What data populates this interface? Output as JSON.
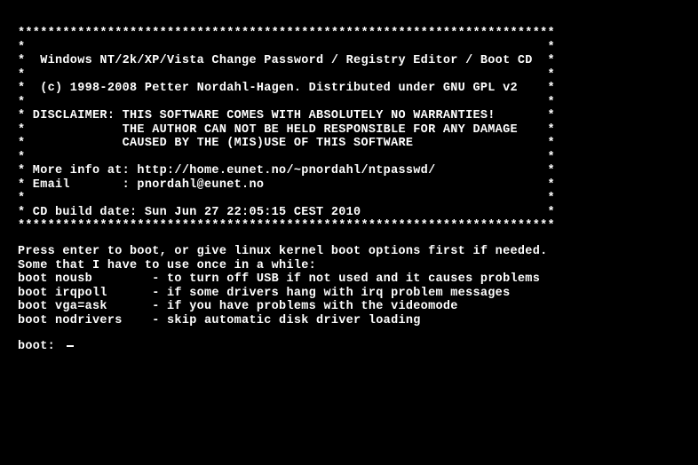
{
  "banner": {
    "border": "************************************************************************",
    "rows": [
      "*                                                                      *",
      "*  Windows NT/2k/XP/Vista Change Password / Registry Editor / Boot CD  *",
      "*                                                                      *",
      "*  (c) 1998-2008 Petter Nordahl-Hagen. Distributed under GNU GPL v2    *",
      "*                                                                      *",
      "* DISCLAIMER: THIS SOFTWARE COMES WITH ABSOLUTELY NO WARRANTIES!       *",
      "*             THE AUTHOR CAN NOT BE HELD RESPONSIBLE FOR ANY DAMAGE    *",
      "*             CAUSED BY THE (MIS)USE OF THIS SOFTWARE                  *",
      "*                                                                      *",
      "* More info at: http://home.eunet.no/~pnordahl/ntpasswd/               *",
      "* Email       : pnordahl@eunet.no                                      *",
      "*                                                                      *",
      "* CD build date: Sun Jun 27 22:05:15 CEST 2010                         *"
    ]
  },
  "instructions": {
    "intro1": "Press enter to boot, or give linux kernel boot options first if needed.",
    "intro2": "Some that I have to use once in a while:",
    "opts": [
      "boot nousb        - to turn off USB if not used and it causes problems",
      "boot irqpoll      - if some drivers hang with irq problem messages",
      "boot vga=ask      - if you have problems with the videomode",
      "boot nodrivers    - skip automatic disk driver loading"
    ]
  },
  "prompt": {
    "label": "boot: ",
    "value": ""
  }
}
